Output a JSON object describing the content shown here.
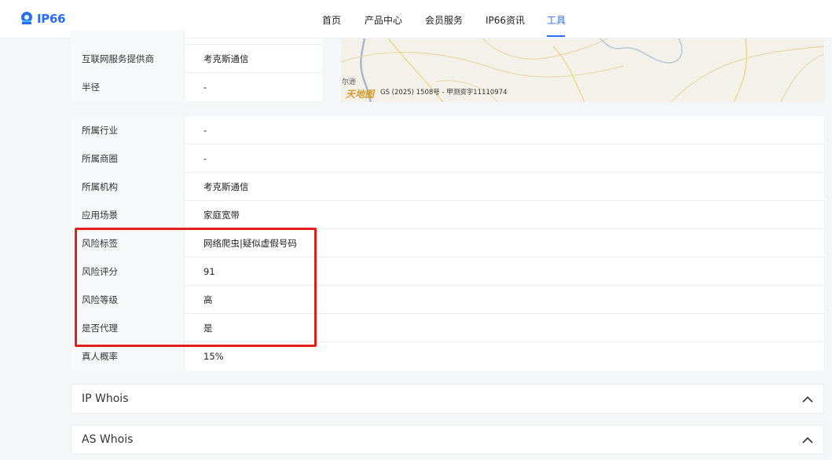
{
  "header": {
    "logo_text": "IP66",
    "nav": [
      {
        "label": "首页"
      },
      {
        "label": "产品中心"
      },
      {
        "label": "会员服务"
      },
      {
        "label": "IP66资讯"
      },
      {
        "label": "工具",
        "active": true
      }
    ],
    "accent_color": "#2b6cff"
  },
  "top_table": {
    "rows": [
      {
        "key": "互联网服务提供商",
        "value": "考克斯通信"
      },
      {
        "key": "半径",
        "value": "-"
      }
    ]
  },
  "map": {
    "place_label": "尔逊",
    "copyright": "GS (2025) 1508号 - 甲测资字11110974"
  },
  "detail_table": {
    "rows": [
      {
        "key": "所属行业",
        "value": "-"
      },
      {
        "key": "所属商圈",
        "value": "-"
      },
      {
        "key": "所属机构",
        "value": "考克斯通信"
      },
      {
        "key": "应用场景",
        "value": "家庭宽带"
      },
      {
        "key": "风险标签",
        "value": "网络爬虫|疑似虚假号码"
      },
      {
        "key": "风险评分",
        "value": "91"
      },
      {
        "key": "风险等级",
        "value": "高"
      },
      {
        "key": "是否代理",
        "value": "是"
      },
      {
        "key": "真人概率",
        "value": "15%"
      }
    ],
    "highlight_color": "#e41e1e"
  },
  "accordions": [
    {
      "title": "IP Whois"
    },
    {
      "title": "AS Whois"
    }
  ]
}
